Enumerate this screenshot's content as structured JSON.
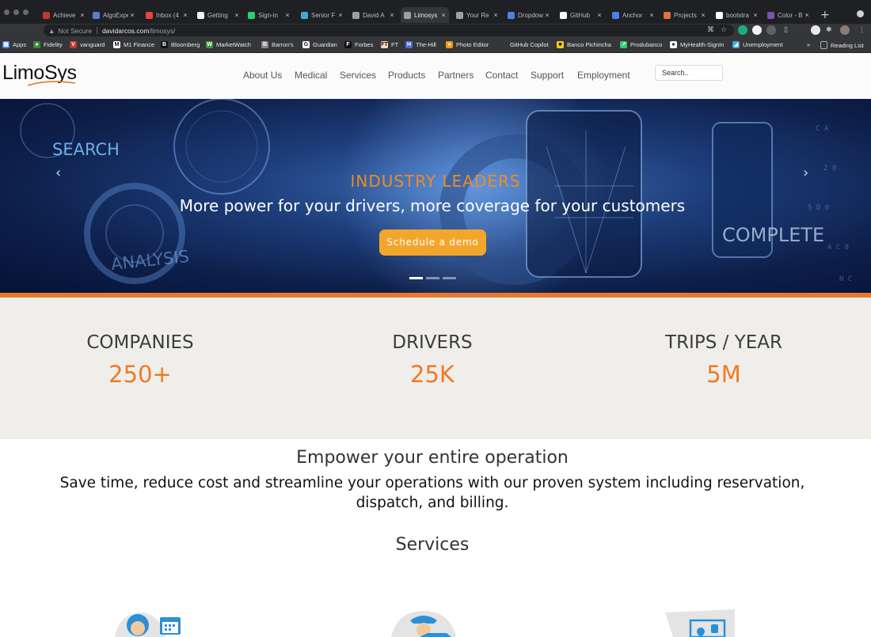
{
  "browser": {
    "tabs": [
      {
        "title": "Achieve",
        "color": "#c0392b"
      },
      {
        "title": "AlgoExpert",
        "color": "#5b7bd5"
      },
      {
        "title": "Inbox (4",
        "color": "#e8453c"
      },
      {
        "title": "Getting",
        "color": "#f0f0f0"
      },
      {
        "title": "Sign-in",
        "color": "#2ecc71"
      },
      {
        "title": "Senior F",
        "color": "#3fa9d6"
      },
      {
        "title": "David A",
        "color": "#9aa0a6"
      },
      {
        "title": "Limosys",
        "color": "#9aa0a6"
      },
      {
        "title": "Your Re",
        "color": "#9aa0a6"
      },
      {
        "title": "Dropdow",
        "color": "#4a7ff0"
      },
      {
        "title": "GitHub",
        "color": "#ffffff"
      },
      {
        "title": "Anchor",
        "color": "#4a7ff0"
      },
      {
        "title": "Projects",
        "color": "#e2733a"
      },
      {
        "title": "bootstra",
        "color": "#ffffff"
      },
      {
        "title": "Color - B",
        "color": "#7952b3"
      }
    ],
    "not_secure": "Not Secure",
    "url_host": "davidarcos.com",
    "url_path": "/limosys/",
    "bookmarks": [
      {
        "label": "Apps",
        "icon": "▦",
        "color": "#4285f4"
      },
      {
        "label": "Fidelity",
        "icon": "●",
        "color": "#3a8a3a"
      },
      {
        "label": "vanguard",
        "icon": "V",
        "color": "#c0392b"
      },
      {
        "label": "M1 Finance",
        "icon": "M",
        "color": "#ffffff"
      },
      {
        "label": "Bloomberg",
        "icon": "B",
        "color": "#111111"
      },
      {
        "label": "MarketWatch",
        "icon": "W",
        "color": "#3c9a3c"
      },
      {
        "label": "Barron's",
        "icon": "B",
        "color": "#888888"
      },
      {
        "label": "Guardian",
        "icon": "G",
        "color": "#ffffff"
      },
      {
        "label": "Forbes",
        "icon": "F",
        "color": "#111111"
      },
      {
        "label": "FT",
        "icon": "FT",
        "color": "#f2d8c4"
      },
      {
        "label": "The-Hill",
        "icon": "H",
        "color": "#4a6fd0"
      },
      {
        "label": "Photo Editor",
        "icon": "●",
        "color": "#f39c12"
      },
      {
        "label": "GitHub Copilot",
        "icon": "",
        "color": "#35363a"
      },
      {
        "label": "Banco Pichincha",
        "icon": "■",
        "color": "#f5d10d"
      },
      {
        "label": "Produbanco",
        "icon": "↗",
        "color": "#2ecc71"
      },
      {
        "label": "MyHealth-SignIn",
        "icon": "●",
        "color": "#ffffff"
      },
      {
        "label": "Unemployment",
        "icon": "◢",
        "color": "#3fa9d6"
      }
    ],
    "overflow": "»",
    "reading_list": "Reading List"
  },
  "site": {
    "logo": "LimoSys",
    "nav": [
      "About Us",
      "Medical",
      "Services",
      "Products",
      "Partners",
      "Contact",
      "Support",
      "Employment"
    ],
    "search_placeholder": "Search.."
  },
  "hero": {
    "eyebrow": "INDUSTRY LEADERS",
    "headline": "More power for your drivers, more coverage for your customers",
    "cta": "Schedule a demo",
    "words": [
      "SEARCH",
      "ANALYSIS",
      "COMPLETE"
    ],
    "slides_total": 3,
    "active_slide": 1
  },
  "stats": [
    {
      "label": "COMPANIES",
      "value": "250+"
    },
    {
      "label": "DRIVERS",
      "value": "25K"
    },
    {
      "label": "TRIPS / YEAR",
      "value": "5M"
    }
  ],
  "content": {
    "heading": "Empower your entire operation",
    "description": "Save time, reduce cost and streamline your operations with our proven system including reservation, dispatch, and billing.",
    "services_title": "Services"
  },
  "colors": {
    "accent": "#ef7a23",
    "cta": "#f4a52c",
    "stats_bg": "#f0eeeb"
  }
}
